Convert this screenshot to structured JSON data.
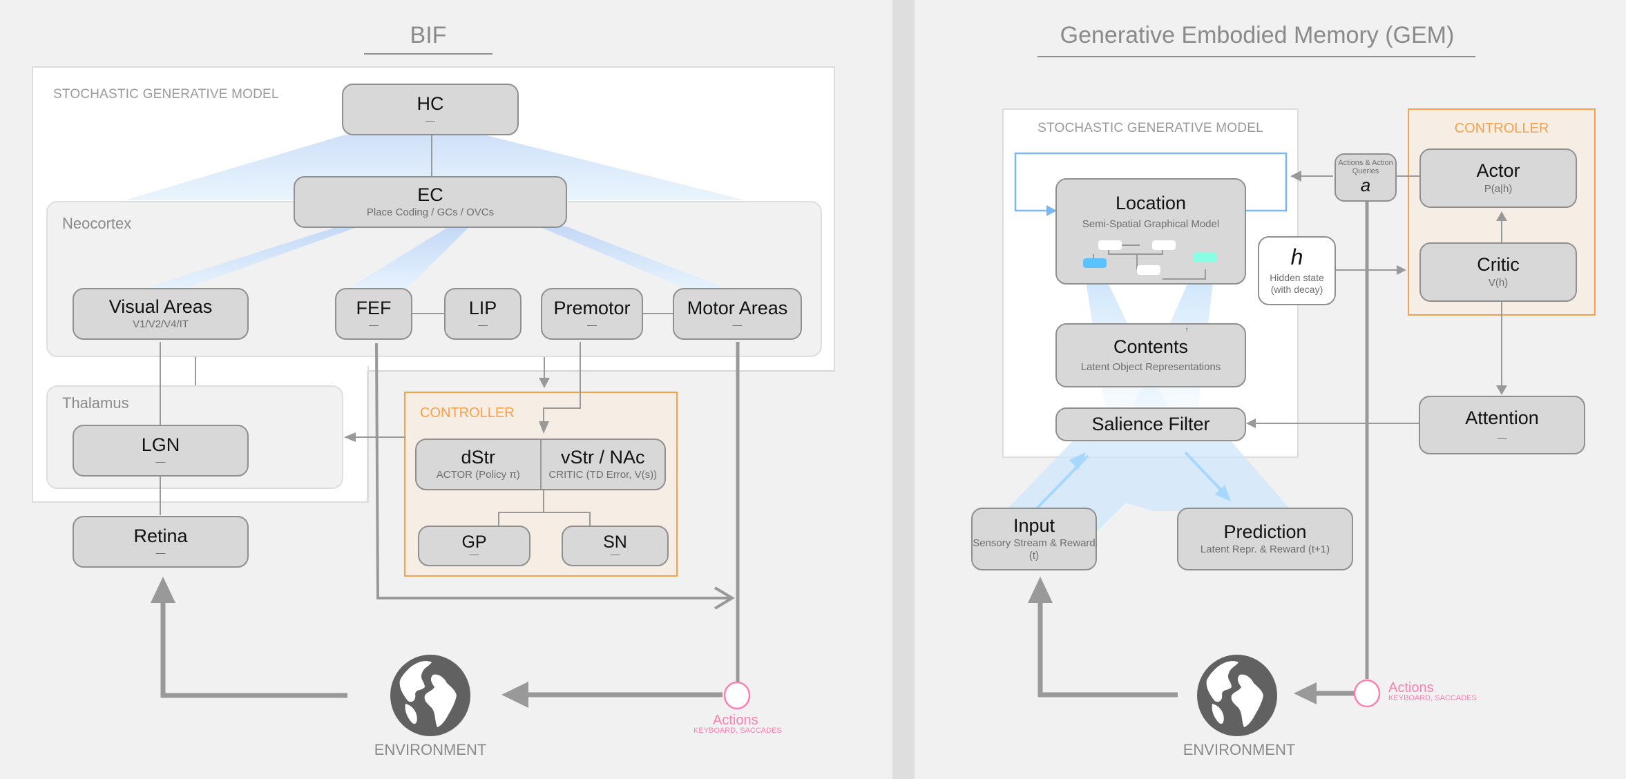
{
  "left": {
    "title": "BIF",
    "model_label": "STOCHASTIC GENERATIVE MODEL",
    "neocortex_label": "Neocortex",
    "thalamus_label": "Thalamus",
    "controller_label": "CONTROLLER",
    "nodes": {
      "hc": {
        "name": "HC",
        "sub": "—"
      },
      "ec": {
        "name": "EC",
        "sub": "Place Coding / GCs / OVCs"
      },
      "visual": {
        "name": "Visual Areas",
        "sub": "V1/V2/V4/IT"
      },
      "fef": {
        "name": "FEF",
        "sub": "—"
      },
      "lip": {
        "name": "LIP",
        "sub": "—"
      },
      "premotor": {
        "name": "Premotor",
        "sub": "—"
      },
      "motor": {
        "name": "Motor Areas",
        "sub": "—"
      },
      "lgn": {
        "name": "LGN",
        "sub": "—"
      },
      "retina": {
        "name": "Retina",
        "sub": "—"
      },
      "dstr": {
        "name": "dStr",
        "sub": "ACTOR (Policy π)"
      },
      "vstr": {
        "name": "vStr / NAc",
        "sub": "CRITIC (TD Error, V(s))"
      },
      "gp": {
        "name": "GP",
        "sub": "—"
      },
      "sn": {
        "name": "SN",
        "sub": "—"
      }
    },
    "environment_label": "ENVIRONMENT",
    "actions_label": "Actions",
    "actions_sub": "KEYBOARD, SACCADES"
  },
  "right": {
    "title": "Generative Embodied Memory (GEM)",
    "model_label": "STOCHASTIC GENERATIVE MODEL",
    "controller_label": "CONTROLLER",
    "nodes": {
      "location": {
        "name": "Location",
        "sub": "Semi-Spatial Graphical Model"
      },
      "contents": {
        "name": "Contents",
        "sub": "Latent Object Representations",
        "mark": "t"
      },
      "salience": {
        "name": "Salience Filter"
      },
      "actions_box": {
        "caption": "Actions & Action Queries",
        "symbol": "a"
      },
      "hidden": {
        "symbol": "h",
        "sub": "Hidden state (with decay)"
      },
      "actor": {
        "name": "Actor",
        "sub": "P(a|h)"
      },
      "critic": {
        "name": "Critic",
        "sub": "V(h)"
      },
      "attention": {
        "name": "Attention",
        "sub": "—"
      },
      "input": {
        "name": "Input",
        "sub": "Sensory Stream & Reward (t)"
      },
      "prediction": {
        "name": "Prediction",
        "sub": "Latent Repr. & Reward (t+1)"
      }
    },
    "environment_label": "ENVIRONMENT",
    "actions_label": "Actions",
    "actions_sub": "KEYBOARD, SACCADES"
  },
  "colors": {
    "controller": "#f7a24b",
    "actions": "#ff7eb3",
    "node_fill": "#d8d8d8",
    "wire": "#999999",
    "recurrence": "#7ab8f5",
    "highlight_blue": "#5ac2ff",
    "highlight_teal": "#88ffe4"
  }
}
